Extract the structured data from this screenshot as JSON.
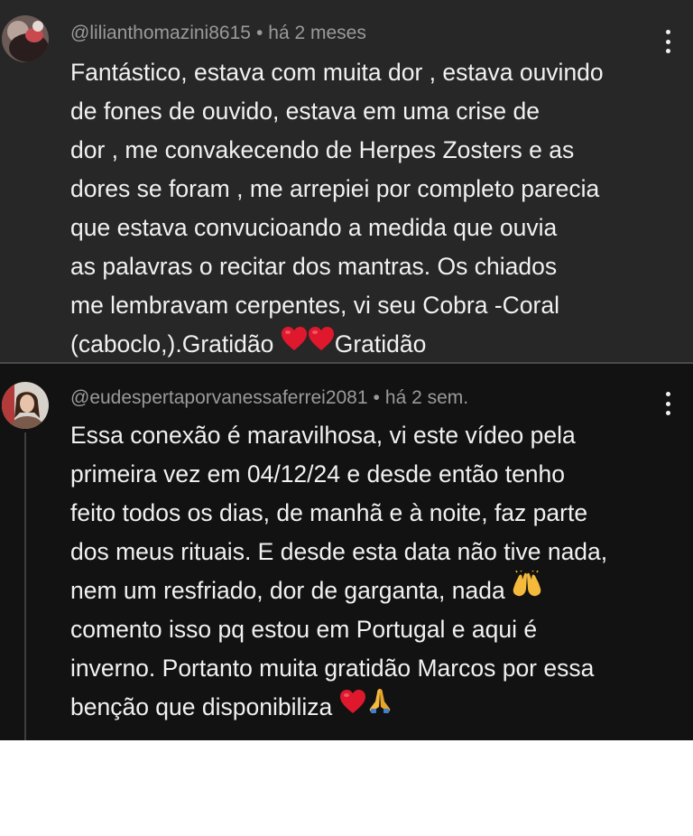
{
  "comments": [
    {
      "author": "@lilianthomazini8615",
      "separator": "•",
      "time": "há 2 meses",
      "lines": [
        "Fantástico, estava com muita dor , estava ouvindo",
        "de fones de ouvido,  estava em uma crise de",
        "dor , me convakecendo de Herpes Zosters e as",
        "dores se foram , me arrepiei por completo parecia",
        "que estava convucioando a medida que ouvia",
        "as palavras o recitar dos mantras. Os chiados",
        "me lembravam cerpentes, vi seu Cobra -Coral"
      ],
      "last_line_start": "(caboclo,).Gratidão ",
      "last_line_end": "Gratidão"
    },
    {
      "author": "@eudespertaporvanessaferrei2081",
      "separator": "•",
      "time": "há 2 sem.",
      "lines": [
        "Essa conexão é maravilhosa, vi este vídeo pela",
        "primeira vez em 04/12/24 e desde então tenho",
        "feito todos os dias, de manhã e à noite, faz parte",
        "dos meus rituais. E desde esta data não tive nada,"
      ],
      "line5_text": "nem um resfriado, dor de garganta, nada ",
      "lines_after": [
        "comento isso pq estou em Portugal e aqui é",
        "inverno. Portanto muita gratidão Marcos por essa"
      ],
      "last_line_start": "benção que disponibiliza "
    }
  ],
  "colors": {
    "comment1_bg": "#272727",
    "comment2_bg": "#121212",
    "text": "#f1f1f1",
    "meta": "#9a9a9a",
    "heart": "#e0182d"
  },
  "icons": [
    "more-options-icon",
    "red-heart-icon",
    "raising-hands-icon",
    "folded-hands-icon"
  ]
}
